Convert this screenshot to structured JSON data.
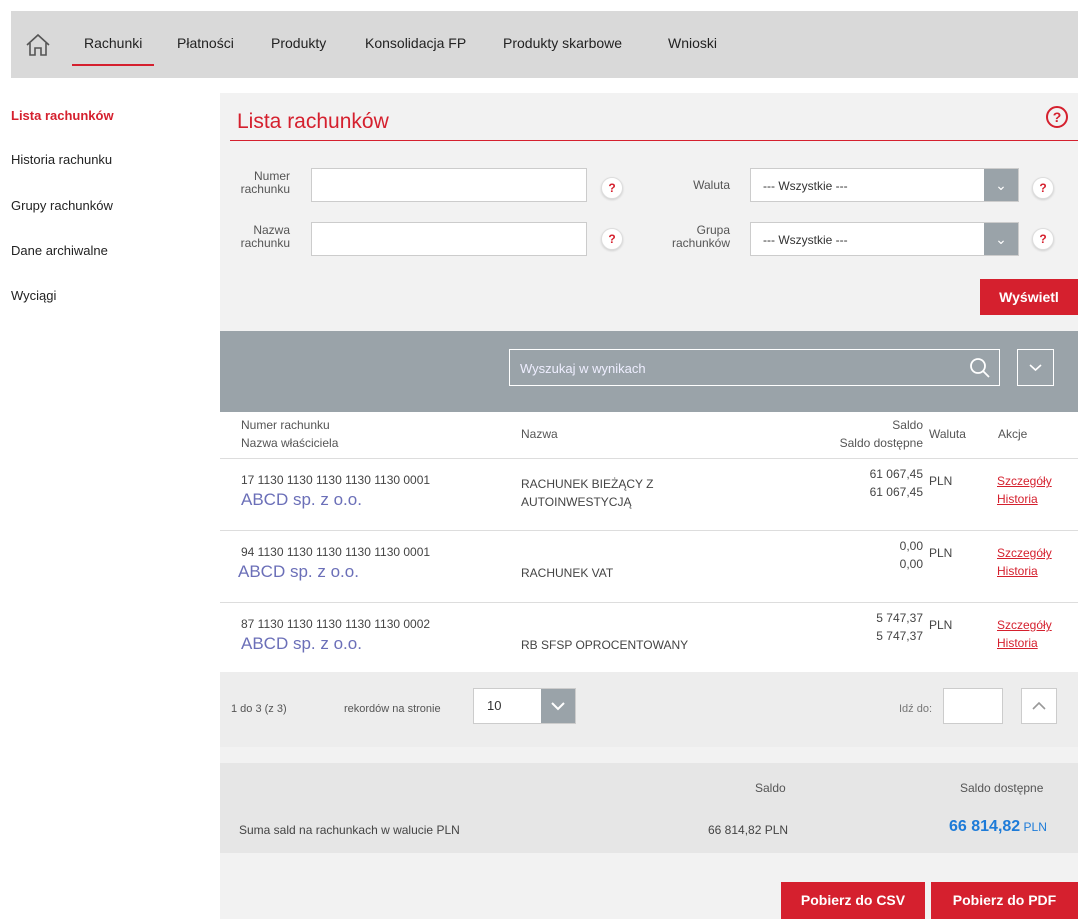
{
  "nav": {
    "items": [
      {
        "label": "Rachunki",
        "active": true
      },
      {
        "label": "Płatności"
      },
      {
        "label": "Produkty"
      },
      {
        "label": "Konsolidacja FP"
      },
      {
        "label": "Produkty skarbowe"
      },
      {
        "label": "Wnioski"
      }
    ]
  },
  "sidebar": {
    "items": [
      {
        "label": "Lista rachunków",
        "active": true
      },
      {
        "label": "Historia rachunku"
      },
      {
        "label": "Grupy rachunków"
      },
      {
        "label": "Dane archiwalne"
      },
      {
        "label": "Wyciągi"
      }
    ]
  },
  "page": {
    "title": "Lista rachunków",
    "help": "?"
  },
  "filters": {
    "account_number_label_1": "Numer",
    "account_number_label_2": "rachunku",
    "account_name_label_1": "Nazwa",
    "account_name_label_2": "rachunku",
    "currency_label": "Waluta",
    "currency_value": "--- Wszystkie ---",
    "group_label_1": "Grupa",
    "group_label_2": "rachunków",
    "group_value": "--- Wszystkie ---",
    "show_button": "Wyświetl"
  },
  "search": {
    "placeholder": "Wyszukaj w wynikach"
  },
  "table": {
    "headers": {
      "number": "Numer rachunku",
      "owner": "Nazwa właściciela",
      "name": "Nazwa",
      "saldo": "Saldo",
      "saldo_available": "Saldo dostępne",
      "currency": "Waluta",
      "actions": "Akcje"
    },
    "rows": [
      {
        "number": "17 1130 1130 1130 1130 1130 0001",
        "owner": "ABCD sp. z o.o.",
        "name_1": "RACHUNEK BIEŻĄCY Z",
        "name_2": "AUTOINWESTYCJĄ",
        "saldo": "61 067,45",
        "available": "61 067,45",
        "currency": "PLN",
        "details": "Szczegóły",
        "history": "Historia"
      },
      {
        "number": "94 1130 1130 1130 1130 1130 0001",
        "owner": "ABCD sp. z o.o.",
        "name_1": "RACHUNEK VAT",
        "name_2": "",
        "saldo": "0,00",
        "available": "0,00",
        "currency": "PLN",
        "details": "Szczegóły",
        "history": "Historia"
      },
      {
        "number": "87 1130 1130 1130 1130 1130 0002",
        "owner": "ABCD sp. z o.o.",
        "name_1": "RB SFSP OPROCENTOWANY",
        "name_2": "",
        "saldo": "5 747,37",
        "available": "5 747,37",
        "currency": "PLN",
        "details": "Szczegóły",
        "history": "Historia"
      }
    ]
  },
  "pager": {
    "range": "1 do 3 (z 3)",
    "per_page_label": "rekordów na stronie",
    "per_page_value": "10",
    "goto_label": "Idź do:"
  },
  "summary": {
    "saldo_header": "Saldo",
    "available_header": "Saldo dostępne",
    "label": "Suma sald na rachunkach w walucie PLN",
    "saldo": "66 814,82 PLN",
    "available_value": "66 814,82",
    "available_currency": "PLN"
  },
  "buttons": {
    "csv": "Pobierz do CSV",
    "pdf": "Pobierz do PDF"
  },
  "colors": {
    "accent": "#d5202e",
    "gray_bar": "#9aa3a9",
    "total_blue": "#1d7bd8"
  }
}
